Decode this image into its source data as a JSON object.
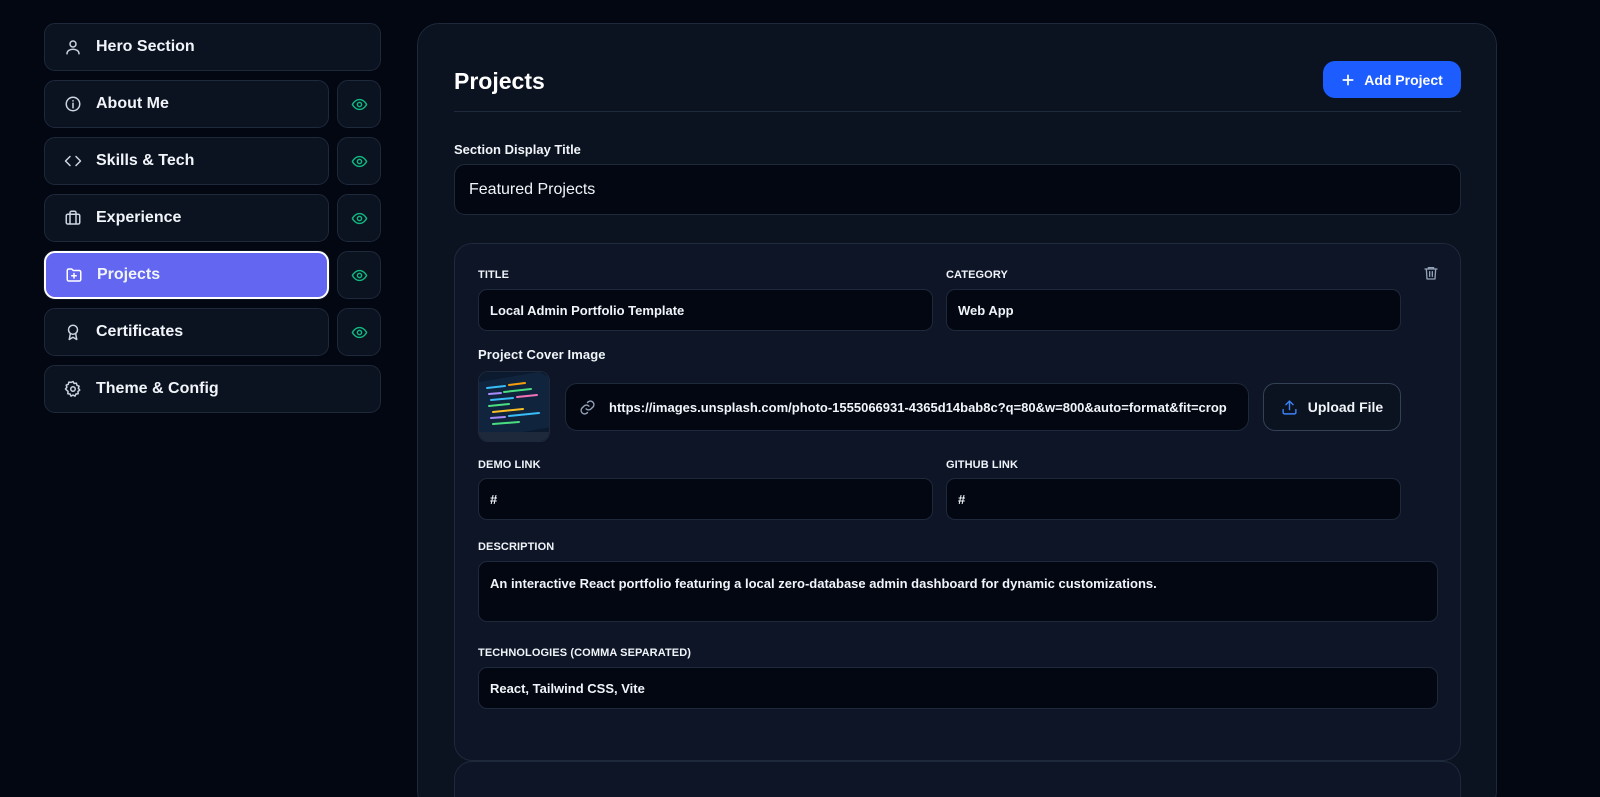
{
  "sidebar": {
    "items": [
      {
        "label": "Hero Section",
        "icon": "user-icon",
        "has_visibility_toggle": false,
        "active": false
      },
      {
        "label": "About Me",
        "icon": "info-icon",
        "has_visibility_toggle": true,
        "active": false
      },
      {
        "label": "Skills & Tech",
        "icon": "code-icon",
        "has_visibility_toggle": true,
        "active": false
      },
      {
        "label": "Experience",
        "icon": "briefcase-icon",
        "has_visibility_toggle": true,
        "active": false
      },
      {
        "label": "Projects",
        "icon": "folder-plus-icon",
        "has_visibility_toggle": true,
        "active": true
      },
      {
        "label": "Certificates",
        "icon": "award-icon",
        "has_visibility_toggle": true,
        "active": false
      },
      {
        "label": "Theme & Config",
        "icon": "settings-icon",
        "has_visibility_toggle": false,
        "active": false
      }
    ]
  },
  "main": {
    "title": "Projects",
    "add_button_label": "Add Project",
    "section_title_label": "Section Display Title",
    "section_title_value": "Featured Projects",
    "project": {
      "title_label": "TITLE",
      "title_value": "Local Admin Portfolio Template",
      "category_label": "CATEGORY",
      "category_value": "Web App",
      "cover_label": "Project Cover Image",
      "cover_url": "https://images.unsplash.com/photo-1555066931-4365d14bab8c?q=80&w=800&auto=format&fit=crop",
      "upload_label": "Upload File",
      "demo_label": "DEMO LINK",
      "demo_value": "#",
      "github_label": "GITHUB LINK",
      "github_value": "#",
      "description_label": "DESCRIPTION",
      "description_value": "An interactive React portfolio featuring a local zero-database admin dashboard for dynamic customizations.",
      "tech_label": "TECHNOLOGIES (COMMA SEPARATED)",
      "tech_value": "React, Tailwind CSS, Vite"
    }
  },
  "colors": {
    "background": "#030712",
    "panel": "#0b1220",
    "accent_active": "#6366f1",
    "primary_button": "#1d5cff",
    "visible_eye": "#10b981",
    "border": "#1e293b"
  }
}
